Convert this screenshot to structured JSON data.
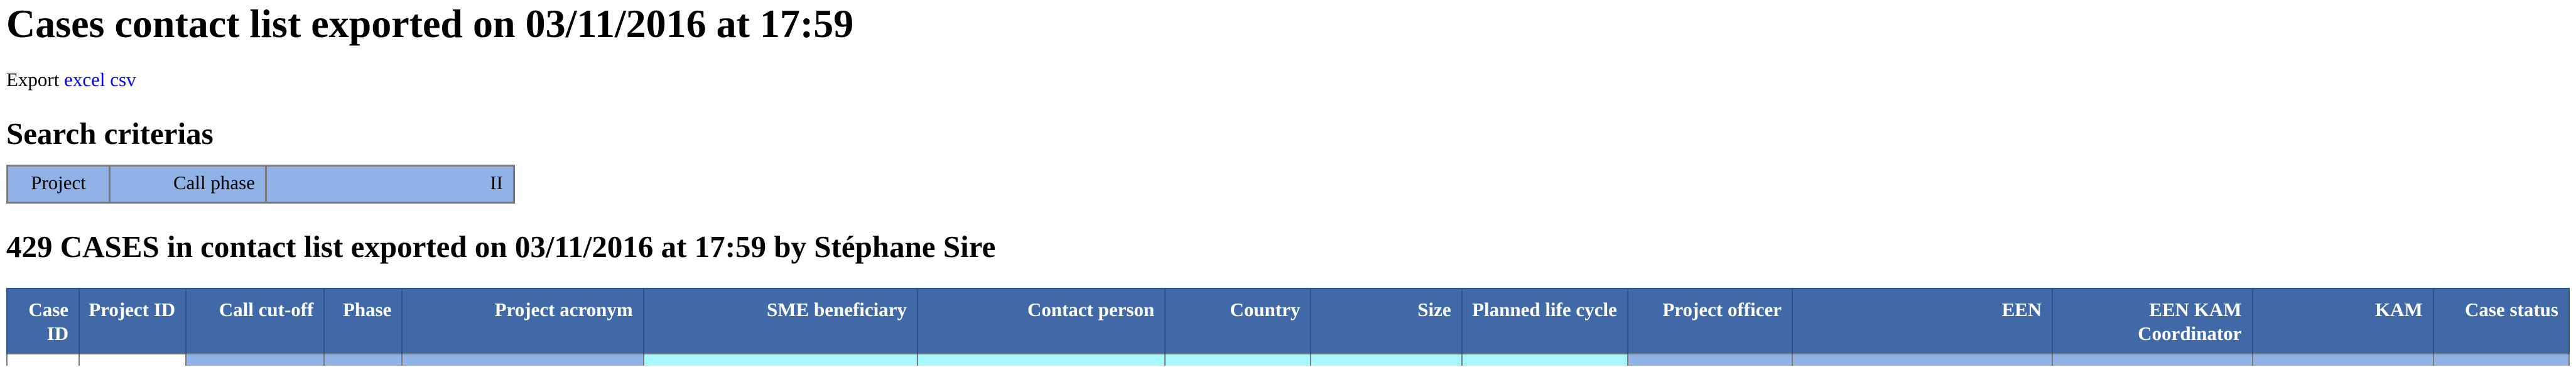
{
  "page": {
    "title": "Cases contact list exported on 03/11/2016 at 17:59"
  },
  "export": {
    "label": "Export",
    "links": [
      "excel",
      "csv"
    ]
  },
  "search": {
    "heading": "Search criterias",
    "criteria": [
      "Project",
      "Call phase",
      "II"
    ]
  },
  "results": {
    "heading": "429 CASES in contact list exported on 03/11/2016 at 17:59 by Stéphane Sire"
  },
  "table": {
    "columns": [
      "Case ID",
      "Project ID",
      "Call cut-off",
      "Phase",
      "Project acronym",
      "SME beneficiary",
      "Contact person",
      "Country",
      "Size",
      "Planned life cycle",
      "Project officer",
      "EEN",
      "EEN KAM Coordinator",
      "KAM",
      "Case status"
    ],
    "first_row_colors": [
      "#ffffff",
      "#ffffff",
      "#91b2e6",
      "#91b2e6",
      "#91b2e6",
      "#aaf8ff",
      "#aaf8ff",
      "#aaf8ff",
      "#aaf8ff",
      "#aaf8ff",
      "#91b2e6",
      "#91b2e6",
      "#91b2e6",
      "#91b2e6",
      "#91b2e6"
    ]
  },
  "colors": {
    "header_bg": "#4169a8",
    "criteria_bg": "#91b2e6",
    "highlight_cyan": "#aaf8ff",
    "link": "#0000ee"
  }
}
